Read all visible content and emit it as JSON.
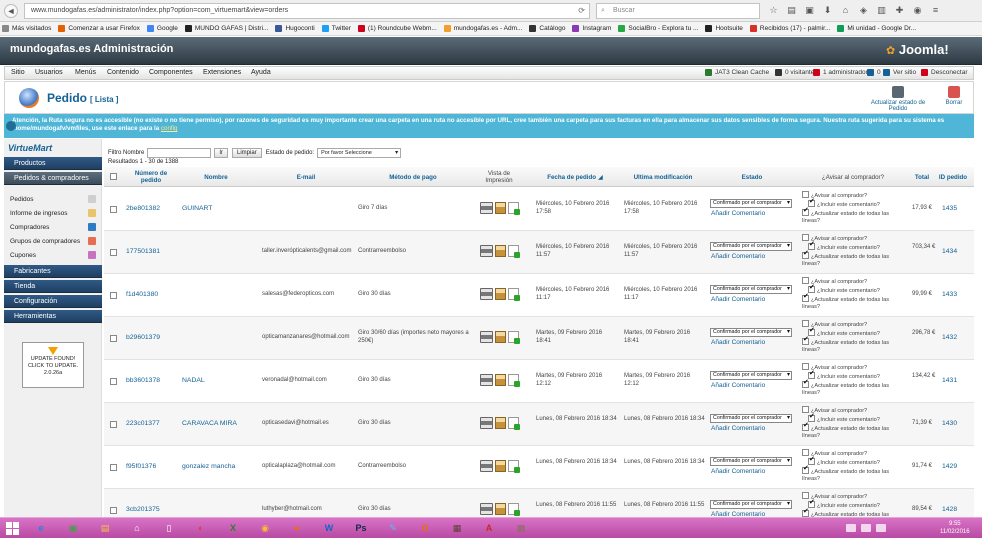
{
  "browser": {
    "url": "www.mundogafas.es/administrator/index.php?option=com_virtuemart&view=orders",
    "search_placeholder": "Buscar",
    "bookmarks": [
      {
        "label": "Más visitados",
        "color": "#888888"
      },
      {
        "label": "Comenzar a usar Firefox",
        "color": "#e66000"
      },
      {
        "label": "Google",
        "color": "#4285f4"
      },
      {
        "label": "MUNDO GAFAS | Distri...",
        "color": "#222222"
      },
      {
        "label": "Hugoconti",
        "color": "#3b5998"
      },
      {
        "label": "Twitter",
        "color": "#1da1f2"
      },
      {
        "label": "(1) Roundcube Webm...",
        "color": "#d0021b"
      },
      {
        "label": "mundogafas.es - Adm...",
        "color": "#f49f2b"
      },
      {
        "label": "Catálogo",
        "color": "#333333"
      },
      {
        "label": "Instagram",
        "color": "#8a3ab9"
      },
      {
        "label": "SocialBro - Explora tu ...",
        "color": "#28a745"
      },
      {
        "label": "Hootsuite",
        "color": "#222222"
      },
      {
        "label": "Recibidos (17) - palmir...",
        "color": "#d93025"
      },
      {
        "label": "Mi unidad - Google Dr...",
        "color": "#0f9d58"
      }
    ]
  },
  "header": {
    "title": "mundogafas.es Administración",
    "logo": "Joomla!"
  },
  "menu": {
    "items": [
      "Sitio",
      "Usuarios",
      "Menús",
      "Contenido",
      "Componentes",
      "Extensiones",
      "Ayuda"
    ],
    "status": [
      {
        "label": "JAT3 Clean Cache",
        "color": "#2c7a2c"
      },
      {
        "label": "0 visitantes",
        "color": "#333333"
      },
      {
        "label": "1 administrador",
        "color": "#d0021b"
      },
      {
        "label": "0",
        "color": "#146295"
      },
      {
        "label": "Ver sitio",
        "color": "#146295"
      },
      {
        "label": "Desconectar",
        "color": "#d0021b"
      }
    ]
  },
  "toolbar": {
    "title": "Pedido",
    "subtitle": "[ Lista ]",
    "update_label": "Actualizar estado de Pedido",
    "delete_label": "Borrar"
  },
  "alert": {
    "prefix": "Atención, la Ruta segura no es ",
    "strong": "accesible",
    "text": " (no existe o no tiene permiso), por razones de seguridad es muy importante crear una carpeta en una ruta no accesible por URL, cree también una carpeta para sus facturas en ella para almacenar sus datos sensibles de forma segura. Nuestra ruta sugerida para su sistema es /home/mundogafv/vmfiles, use este enlace para la ",
    "link": "config"
  },
  "sidebar": {
    "brand": "VirtueMart",
    "sections": [
      {
        "label": "Productos",
        "active": false
      },
      {
        "label": "Pedidos & compradores",
        "active": true
      }
    ],
    "subitems": [
      {
        "label": "Pedidos",
        "color": "#cfcfcf"
      },
      {
        "label": "Informe de ingresos",
        "color": "#e9c46a"
      },
      {
        "label": "Compradores",
        "color": "#2f7cc5"
      },
      {
        "label": "Grupos de compradores",
        "color": "#e76f51"
      },
      {
        "label": "Cupones",
        "color": "#c774c0"
      }
    ],
    "bottom_sections": [
      "Fabricantes",
      "Tienda",
      "Configuración",
      "Herramientas"
    ],
    "update_box": {
      "line1": "UPDATE FOUND!",
      "line2": "CLICK TO UPDATE.",
      "line3": "2.0.26a"
    }
  },
  "filters": {
    "name_label": "Filtro Nombre",
    "go": "Ir",
    "clear": "Limpiar",
    "status_label": "Estado de pedido:",
    "status_value": "Por favor Seleccione"
  },
  "results": "Resultados 1 - 30 de 1388",
  "columns": {
    "number": "Número de pedido",
    "name": "Nombre",
    "email": "E-mail",
    "payment": "Método de pago",
    "print": "Vista de Impresión",
    "date": "Fecha de pedido",
    "modified": "Ultima modificación",
    "status": "Estado",
    "notify": "¿Avisar al comprador?",
    "total": "Total",
    "id": "ID pedido"
  },
  "row_labels": {
    "status_value": "Confirmado por el comprador",
    "add_comment": "Añadir Comentario",
    "notify": "¿Avisar al comprador?",
    "include": "¿Incluir este comentario?",
    "update_lines": "¿Actualizar estado de todas las líneas?"
  },
  "orders": [
    {
      "number": "2be801382",
      "name": "GUINART",
      "email": "",
      "payment": "Giro 7 días",
      "date": "Miércoles, 10 Febrero 2016 17:58",
      "modified": "Miércoles, 10 Febrero 2016 17:58",
      "total": "17,93 €",
      "id": "1435"
    },
    {
      "number": "177501381",
      "name": "",
      "email": "taller.inverópticalents@gmail.com",
      "payment": "Contrarreembolso",
      "date": "Miércoles, 10 Febrero 2016 11:57",
      "modified": "Miércoles, 10 Febrero 2016 11:57",
      "total": "703,34 €",
      "id": "1434"
    },
    {
      "number": "f1d401380",
      "name": "",
      "email": "salesas@federopticos.com",
      "payment": "Giro 30 días",
      "date": "Miércoles, 10 Febrero 2016 11:17",
      "modified": "Miércoles, 10 Febrero 2016 11:17",
      "total": "99,99 €",
      "id": "1433"
    },
    {
      "number": "b29601379",
      "name": "",
      "email": "opticamanzanares@hotmail.com",
      "payment": "Giro 30/60 días (importes neto mayores a 250€)",
      "date": "Martes, 09 Febrero 2016 18:41",
      "modified": "Martes, 09 Febrero 2016 18:41",
      "total": "296,78 €",
      "id": "1432"
    },
    {
      "number": "bb3601378",
      "name": "NADAL",
      "email": "veronadal@hotmail.com",
      "payment": "Giro 30 días",
      "date": "Martes, 09 Febrero 2016 12:12",
      "modified": "Martes, 09 Febrero 2016 12:12",
      "total": "134,42 €",
      "id": "1431"
    },
    {
      "number": "223c01377",
      "name": "CARAVACA MIRA",
      "email": "opticasedavi@hotmail.es",
      "payment": "Giro 30 días",
      "date": "Lunes, 08 Febrero 2016 18:34",
      "modified": "Lunes, 08 Febrero 2016 18:34",
      "total": "71,39 €",
      "id": "1430"
    },
    {
      "number": "f95f01376",
      "name": "gonzalez mancha",
      "email": "opticalaplaza@hotmail.com",
      "payment": "Contrarreembolso",
      "date": "Lunes, 08 Febrero 2016 18:34",
      "modified": "Lunes, 08 Febrero 2016 18:34",
      "total": "91,74 €",
      "id": "1429"
    },
    {
      "number": "3cb201375",
      "name": "",
      "email": "luthyber@hotmail.com",
      "payment": "Giro 30 días",
      "date": "Lunes, 08 Febrero 2016 11:55",
      "modified": "Lunes, 08 Febrero 2016 11:55",
      "total": "89,54 €",
      "id": "1428"
    }
  ],
  "taskbar": {
    "apps": [
      {
        "icon": "ie-icon",
        "glyph": "e",
        "color": "#1e88e5"
      },
      {
        "icon": "store-icon",
        "glyph": "▣",
        "color": "#43a047"
      },
      {
        "icon": "folder-icon",
        "glyph": "▤",
        "color": "#f4c542"
      },
      {
        "icon": "home-icon",
        "glyph": "⌂",
        "color": "#ffffff"
      },
      {
        "icon": "file-icon",
        "glyph": "▯",
        "color": "#ffffff"
      },
      {
        "icon": "headphones-icon",
        "glyph": "◐",
        "color": "#e53935"
      },
      {
        "icon": "excel-icon",
        "glyph": "X",
        "color": "#2e7d32"
      },
      {
        "icon": "chrome-icon",
        "glyph": "◉",
        "color": "#fbc02d"
      },
      {
        "icon": "firefox-icon",
        "glyph": "●",
        "color": "#ef6c00"
      },
      {
        "icon": "word-icon",
        "glyph": "W",
        "color": "#1565c0"
      },
      {
        "icon": "photoshop-icon",
        "glyph": "Ps",
        "color": "#0d2a4a"
      },
      {
        "icon": "paint-icon",
        "glyph": "✎",
        "color": "#4fc3f7"
      },
      {
        "icon": "outlook-icon",
        "glyph": "O",
        "color": "#ef6c00"
      },
      {
        "icon": "gallery-icon",
        "glyph": "▦",
        "color": "#5d4037"
      },
      {
        "icon": "acrobat-icon",
        "glyph": "A",
        "color": "#c62828"
      },
      {
        "icon": "chat-icon",
        "glyph": "▩",
        "color": "#8d6e63"
      }
    ],
    "time": "9:55",
    "date": "11/02/2016"
  }
}
